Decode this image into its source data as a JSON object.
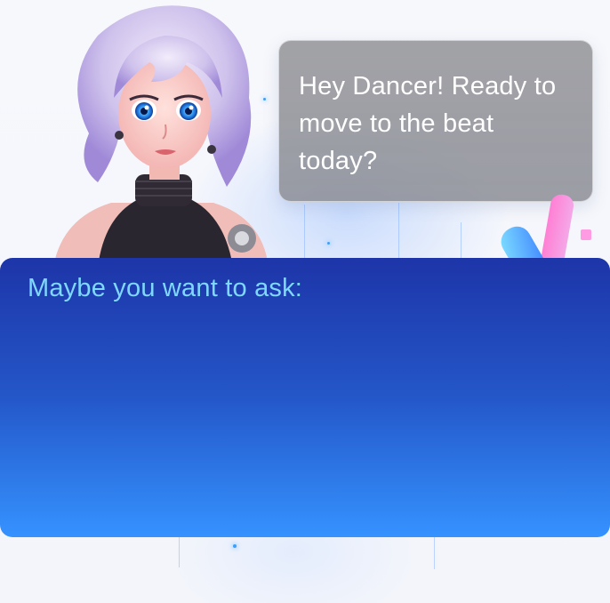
{
  "bubble": {
    "text": "Hey Dancer! Ready to move to the beat today?"
  },
  "suggestions": {
    "title": "Maybe you want to ask:",
    "items": []
  },
  "colors": {
    "panel_top": "#1d35a8",
    "panel_bottom": "#3592ff",
    "title_text": "#7fd8ff",
    "bubble_bg": "#96969a"
  },
  "icons": [
    "avatar-illustration",
    "glow-sticks-decoration"
  ]
}
